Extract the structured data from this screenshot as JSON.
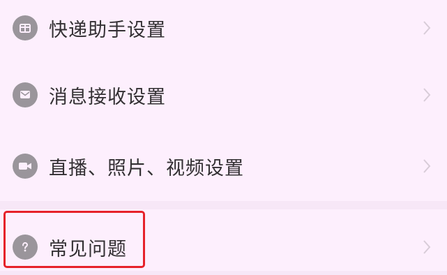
{
  "settings": {
    "items": [
      {
        "label": "快递助手设置",
        "icon": "package-icon"
      },
      {
        "label": "消息接收设置",
        "icon": "message-icon"
      },
      {
        "label": "直播、照片、视频设置",
        "icon": "video-camera-icon"
      },
      {
        "label": "常见问题",
        "icon": "question-icon"
      }
    ]
  },
  "colors": {
    "background": "#f7e7f7",
    "card": "#fdeffd",
    "icon": "#9a959b",
    "text": "#333033",
    "chevron": "#d8ccd8",
    "highlight": "#e6222a"
  }
}
